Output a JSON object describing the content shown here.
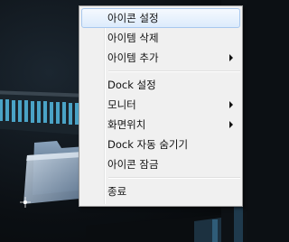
{
  "context_menu": {
    "items": [
      {
        "label": "아이콘 설정",
        "has_submenu": false
      },
      {
        "label": "아이템 삭제",
        "has_submenu": false
      },
      {
        "label": "아이템 추가",
        "has_submenu": true
      },
      {
        "label": "Dock 설정",
        "has_submenu": false
      },
      {
        "label": "모니터",
        "has_submenu": true
      },
      {
        "label": "화면위치",
        "has_submenu": true
      },
      {
        "label": "Dock 자동 숨기기",
        "has_submenu": false
      },
      {
        "label": "아이콘 잠금",
        "has_submenu": false
      },
      {
        "label": "종료",
        "has_submenu": false
      }
    ]
  },
  "colors": {
    "menu_background": "#f0f0f0",
    "highlight": "#dcebfc",
    "highlight_border": "#a8c8ee",
    "dock_bar": "#4aa3c6"
  }
}
